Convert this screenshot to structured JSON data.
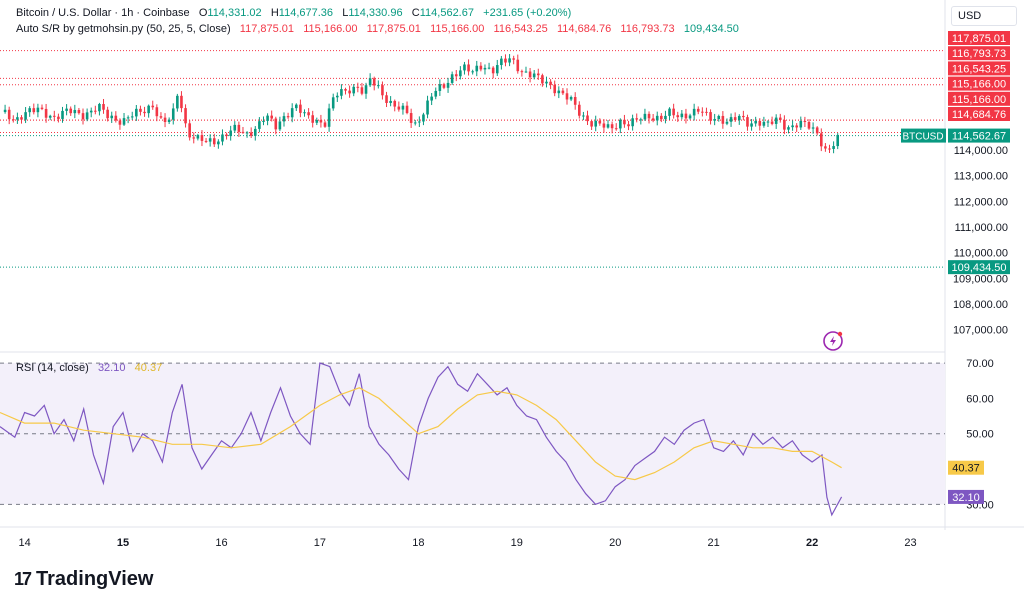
{
  "header": {
    "title": "Bitcoin / U.S. Dollar · 1h · Coinbase",
    "ohlc": [
      {
        "label": "O",
        "value": "114,331.02"
      },
      {
        "label": "H",
        "value": "114,677.36"
      },
      {
        "label": "L",
        "value": "114,330.96"
      },
      {
        "label": "C",
        "value": "114,562.67"
      }
    ],
    "change": "+231.65 (+0.20%)",
    "indicator_name": "Auto S/R by getmohsin.py (50, 25, 5, Close)",
    "indicator_values": [
      "117,875.01",
      "115,166.00",
      "117,875.01",
      "115,166.00",
      "116,543.25",
      "114,684.76",
      "116,793.73",
      "109,434.50"
    ],
    "currency": "USD"
  },
  "rsi_header": {
    "name": "RSI (14, close)",
    "value": "32.10",
    "ma_value": "40.37"
  },
  "brand": {
    "logo_mark": "17",
    "name": "TradingView"
  },
  "colors": {
    "up": "#089981",
    "down": "#f23645",
    "rsi": "#7e57c2",
    "rsi_ma": "#f7c948",
    "rsi_band": "#f3f0fa"
  },
  "chart_data": [
    {
      "type": "candlestick",
      "title": "Bitcoin / U.S. Dollar · 1h · Coinbase",
      "ylim": [
        106400,
        118600
      ],
      "y_ticks": [
        "107,000.00",
        "108,000.00",
        "109,000.00",
        "110,000.00",
        "111,000.00",
        "112,000.00",
        "113,000.00",
        "114,000.00"
      ],
      "x_ticks": [
        {
          "label": "14",
          "day": 14.0
        },
        {
          "label": "15",
          "day": 15.0
        },
        {
          "label": "16",
          "day": 16.0
        },
        {
          "label": "17",
          "day": 17.0
        },
        {
          "label": "18",
          "day": 18.0
        },
        {
          "label": "19",
          "day": 19.0
        },
        {
          "label": "20",
          "day": 20.0
        },
        {
          "label": "21",
          "day": 21.0
        },
        {
          "label": "22",
          "day": 22.0
        },
        {
          "label": "23",
          "day": 23.0
        }
      ],
      "x_domain_days": [
        13.75,
        23.35
      ],
      "close_path": [
        [
          13.75,
          115500
        ],
        [
          13.9,
          115200
        ],
        [
          14.0,
          115450
        ],
        [
          14.15,
          115550
        ],
        [
          14.3,
          115300
        ],
        [
          14.45,
          115500
        ],
        [
          14.6,
          115400
        ],
        [
          14.75,
          115650
        ],
        [
          14.85,
          115300
        ],
        [
          15.0,
          115150
        ],
        [
          15.1,
          115350
        ],
        [
          15.2,
          115500
        ],
        [
          15.3,
          115800
        ],
        [
          15.4,
          115000
        ],
        [
          15.5,
          115250
        ],
        [
          15.55,
          116200
        ],
        [
          15.6,
          115700
        ],
        [
          15.65,
          114700
        ],
        [
          15.75,
          114400
        ],
        [
          15.85,
          114300
        ],
        [
          15.95,
          114400
        ],
        [
          16.05,
          114650
        ],
        [
          16.15,
          114800
        ],
        [
          16.25,
          114600
        ],
        [
          16.35,
          114900
        ],
        [
          16.45,
          115300
        ],
        [
          16.55,
          114900
        ],
        [
          16.65,
          115400
        ],
        [
          16.75,
          115700
        ],
        [
          16.85,
          115300
        ],
        [
          16.95,
          115200
        ],
        [
          17.05,
          115050
        ],
        [
          17.15,
          116100
        ],
        [
          17.3,
          116400
        ],
        [
          17.4,
          116500
        ],
        [
          17.45,
          116100
        ],
        [
          17.5,
          116750
        ],
        [
          17.6,
          116400
        ],
        [
          17.7,
          115900
        ],
        [
          17.8,
          115600
        ],
        [
          17.9,
          115400
        ],
        [
          17.95,
          114900
        ],
        [
          18.05,
          115500
        ],
        [
          18.15,
          116200
        ],
        [
          18.25,
          116450
        ],
        [
          18.35,
          116950
        ],
        [
          18.45,
          117200
        ],
        [
          18.55,
          117000
        ],
        [
          18.65,
          117350
        ],
        [
          18.75,
          117100
        ],
        [
          18.85,
          117400
        ],
        [
          18.95,
          117550
        ],
        [
          19.05,
          117100
        ],
        [
          19.15,
          116900
        ],
        [
          19.25,
          116700
        ],
        [
          19.35,
          116550
        ],
        [
          19.45,
          116200
        ],
        [
          19.55,
          115900
        ],
        [
          19.65,
          115400
        ],
        [
          19.75,
          115100
        ],
        [
          19.85,
          114950
        ],
        [
          19.95,
          114800
        ],
        [
          20.05,
          115150
        ],
        [
          20.15,
          115000
        ],
        [
          20.25,
          115200
        ],
        [
          20.35,
          115350
        ],
        [
          20.45,
          115250
        ],
        [
          20.55,
          115400
        ],
        [
          20.65,
          115300
        ],
        [
          20.75,
          115450
        ],
        [
          20.85,
          115550
        ],
        [
          20.95,
          115200
        ],
        [
          21.05,
          115300
        ],
        [
          21.15,
          115100
        ],
        [
          21.25,
          115250
        ],
        [
          21.35,
          115050
        ],
        [
          21.45,
          115150
        ],
        [
          21.55,
          114950
        ],
        [
          21.65,
          115200
        ],
        [
          21.75,
          114900
        ],
        [
          21.85,
          115000
        ],
        [
          21.95,
          114950
        ],
        [
          22.05,
          114700
        ],
        [
          22.15,
          113900
        ],
        [
          22.25,
          114350
        ],
        [
          22.3,
          114562.67
        ]
      ],
      "annotations": [
        {
          "kind": "resistance",
          "value": 117875.01,
          "label": "117,875.01"
        },
        {
          "kind": "resistance",
          "value": 116793.73,
          "label": "116,793.73"
        },
        {
          "kind": "resistance",
          "value": 116543.25,
          "label": "116,543.25"
        },
        {
          "kind": "resistance",
          "value": 115166.0,
          "label": "115,166.00"
        },
        {
          "kind": "resistance",
          "value": 115166.0,
          "label": "115,166.00"
        },
        {
          "kind": "resistance",
          "value": 114684.76,
          "label": "114,684.76"
        },
        {
          "kind": "current",
          "value": 114562.67,
          "label": "114,562.67",
          "symbol": "BTCUSD"
        },
        {
          "kind": "support",
          "value": 109434.5,
          "label": "109,434.50"
        }
      ]
    },
    {
      "type": "line",
      "title": "RSI (14, close)",
      "ylim": [
        25,
        72
      ],
      "y_ticks": [
        "30.00",
        "50.00",
        "60.00",
        "70.00"
      ],
      "band": [
        30,
        70
      ],
      "mid": 50,
      "series": [
        {
          "name": "RSI",
          "values": [
            [
              13.75,
              52
            ],
            [
              13.9,
              49
            ],
            [
              14.0,
              56
            ],
            [
              14.1,
              55
            ],
            [
              14.2,
              58
            ],
            [
              14.3,
              50
            ],
            [
              14.4,
              54
            ],
            [
              14.5,
              48
            ],
            [
              14.6,
              57
            ],
            [
              14.7,
              44
            ],
            [
              14.8,
              36
            ],
            [
              14.9,
              52
            ],
            [
              15.0,
              56
            ],
            [
              15.1,
              45
            ],
            [
              15.2,
              50
            ],
            [
              15.3,
              48
            ],
            [
              15.4,
              42
            ],
            [
              15.5,
              56
            ],
            [
              15.6,
              64
            ],
            [
              15.7,
              46
            ],
            [
              15.8,
              40
            ],
            [
              15.9,
              44
            ],
            [
              16.0,
              48
            ],
            [
              16.1,
              46
            ],
            [
              16.2,
              50
            ],
            [
              16.3,
              56
            ],
            [
              16.4,
              48
            ],
            [
              16.5,
              56
            ],
            [
              16.6,
              63
            ],
            [
              16.7,
              55
            ],
            [
              16.8,
              50
            ],
            [
              16.9,
              47
            ],
            [
              17.0,
              70
            ],
            [
              17.1,
              69
            ],
            [
              17.2,
              62
            ],
            [
              17.3,
              58
            ],
            [
              17.4,
              67
            ],
            [
              17.5,
              52
            ],
            [
              17.6,
              47
            ],
            [
              17.7,
              44
            ],
            [
              17.8,
              40
            ],
            [
              17.9,
              37
            ],
            [
              18.0,
              52
            ],
            [
              18.1,
              60
            ],
            [
              18.2,
              66
            ],
            [
              18.3,
              69
            ],
            [
              18.4,
              64
            ],
            [
              18.5,
              62
            ],
            [
              18.6,
              67
            ],
            [
              18.7,
              64
            ],
            [
              18.8,
              61
            ],
            [
              18.9,
              63
            ],
            [
              19.0,
              58
            ],
            [
              19.1,
              55
            ],
            [
              19.2,
              54
            ],
            [
              19.3,
              49
            ],
            [
              19.4,
              45
            ],
            [
              19.5,
              42
            ],
            [
              19.6,
              37
            ],
            [
              19.7,
              33
            ],
            [
              19.8,
              30
            ],
            [
              19.9,
              31
            ],
            [
              20.0,
              35
            ],
            [
              20.1,
              37
            ],
            [
              20.2,
              41
            ],
            [
              20.3,
              43
            ],
            [
              20.4,
              45
            ],
            [
              20.5,
              49
            ],
            [
              20.6,
              47
            ],
            [
              20.7,
              51
            ],
            [
              20.8,
              53
            ],
            [
              20.9,
              54
            ],
            [
              21.0,
              46
            ],
            [
              21.1,
              45
            ],
            [
              21.2,
              48
            ],
            [
              21.3,
              44
            ],
            [
              21.4,
              50
            ],
            [
              21.5,
              47
            ],
            [
              21.6,
              49
            ],
            [
              21.7,
              46
            ],
            [
              21.8,
              48
            ],
            [
              21.9,
              44
            ],
            [
              22.0,
              42
            ],
            [
              22.1,
              44
            ],
            [
              22.15,
              32
            ],
            [
              22.2,
              27
            ],
            [
              22.3,
              32.1
            ]
          ]
        },
        {
          "name": "RSI MA",
          "values": [
            [
              13.75,
              56
            ],
            [
              14.0,
              53
            ],
            [
              14.3,
              53
            ],
            [
              14.6,
              51
            ],
            [
              14.9,
              50
            ],
            [
              15.2,
              49
            ],
            [
              15.5,
              47
            ],
            [
              15.8,
              47
            ],
            [
              16.1,
              46
            ],
            [
              16.4,
              47
            ],
            [
              16.7,
              52
            ],
            [
              17.0,
              58
            ],
            [
              17.2,
              61
            ],
            [
              17.4,
              63
            ],
            [
              17.6,
              60
            ],
            [
              17.8,
              55
            ],
            [
              18.0,
              50
            ],
            [
              18.2,
              52
            ],
            [
              18.4,
              57
            ],
            [
              18.6,
              61
            ],
            [
              18.8,
              62
            ],
            [
              19.0,
              61
            ],
            [
              19.2,
              58
            ],
            [
              19.4,
              54
            ],
            [
              19.6,
              48
            ],
            [
              19.8,
              42
            ],
            [
              20.0,
              38
            ],
            [
              20.2,
              37
            ],
            [
              20.4,
              39
            ],
            [
              20.6,
              42
            ],
            [
              20.8,
              46
            ],
            [
              21.0,
              48
            ],
            [
              21.2,
              47
            ],
            [
              21.4,
              46
            ],
            [
              21.6,
              46
            ],
            [
              21.8,
              45
            ],
            [
              22.0,
              45
            ],
            [
              22.2,
              42
            ],
            [
              22.3,
              40.37
            ]
          ]
        }
      ]
    }
  ]
}
